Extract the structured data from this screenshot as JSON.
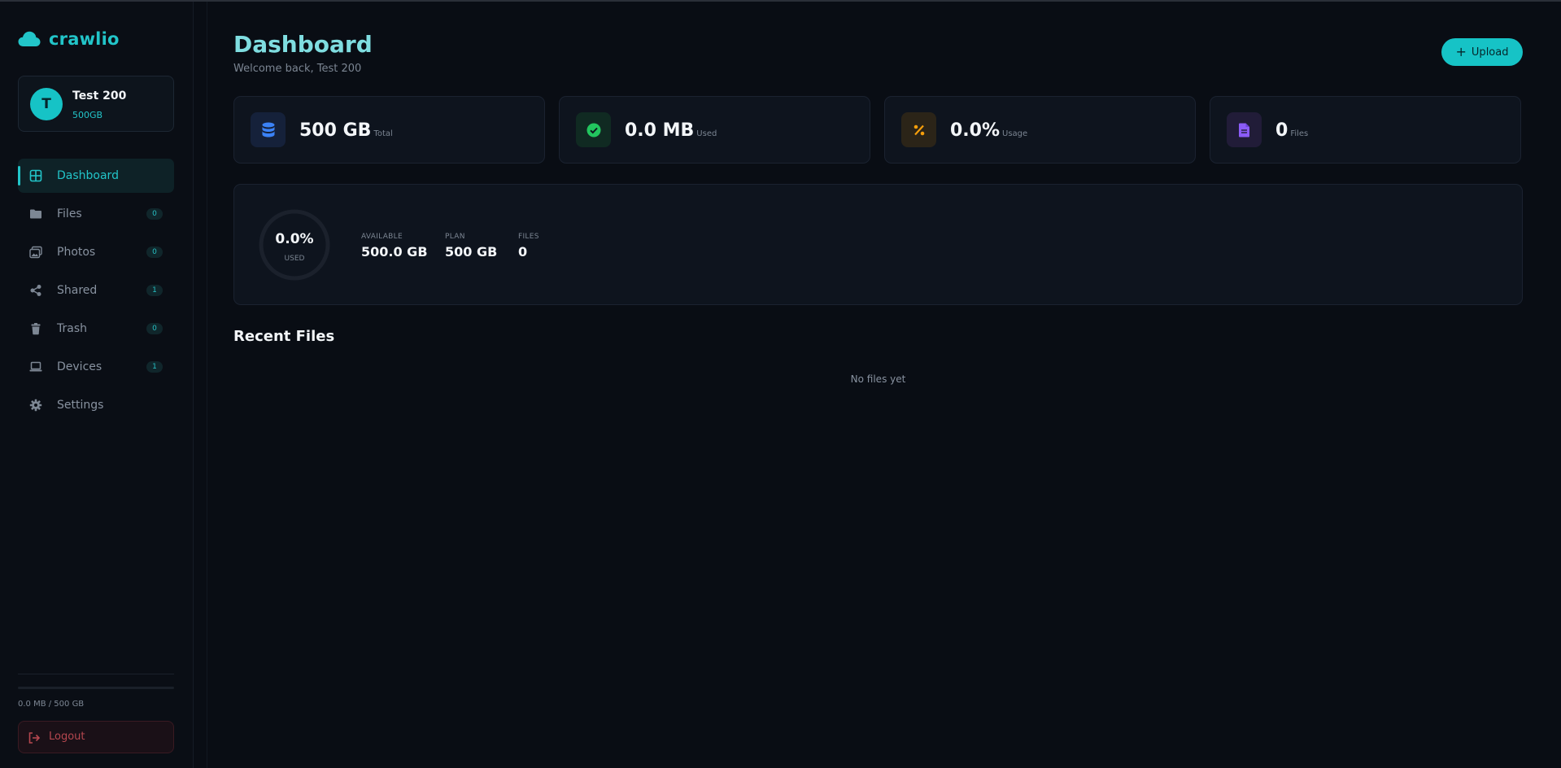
{
  "brand": {
    "name": "crawlio"
  },
  "user": {
    "initial": "T",
    "name": "Test 200",
    "plan": "500GB"
  },
  "nav": [
    {
      "id": "dashboard",
      "label": "Dashboard",
      "active": true
    },
    {
      "id": "files",
      "label": "Files",
      "badge": "0"
    },
    {
      "id": "photos",
      "label": "Photos",
      "badge": "0"
    },
    {
      "id": "shared",
      "label": "Shared",
      "badge": "1"
    },
    {
      "id": "trash",
      "label": "Trash",
      "badge": "0"
    },
    {
      "id": "devices",
      "label": "Devices",
      "badge": "1"
    },
    {
      "id": "settings",
      "label": "Settings"
    }
  ],
  "sidebar_footer": {
    "usage_text": "0.0 MB / 500 GB",
    "usage_fraction": 0.0,
    "logout_label": "Logout"
  },
  "header": {
    "title": "Dashboard",
    "subtitle": "Welcome back, Test 200",
    "upload_label": "Upload"
  },
  "stats": [
    {
      "id": "total",
      "value": "500 GB",
      "label": "Total",
      "icon": "database-icon",
      "color": "#3b82f6"
    },
    {
      "id": "used",
      "value": "0.0 MB",
      "label": "Used",
      "icon": "check-circle-icon",
      "color": "#22c55e"
    },
    {
      "id": "usage",
      "value": "0.0%",
      "label": "Usage",
      "icon": "percent-icon",
      "color": "#f59e0b"
    },
    {
      "id": "files",
      "value": "0",
      "label": "Files",
      "icon": "document-icon",
      "color": "#8b5cf6"
    }
  ],
  "summary": {
    "ring_value": "0.0%",
    "ring_label": "USED",
    "used_fraction": 0.0,
    "available_label": "AVAILABLE",
    "available_value": "500.0 GB",
    "plan_label": "PLAN",
    "plan_value": "500 GB",
    "files_label": "FILES",
    "files_value": "0"
  },
  "recent": {
    "title": "Recent Files",
    "empty_text": "No files yet"
  },
  "colors": {
    "accent": "#22c5c9",
    "background": "#090d14",
    "danger": "#b5474f"
  }
}
